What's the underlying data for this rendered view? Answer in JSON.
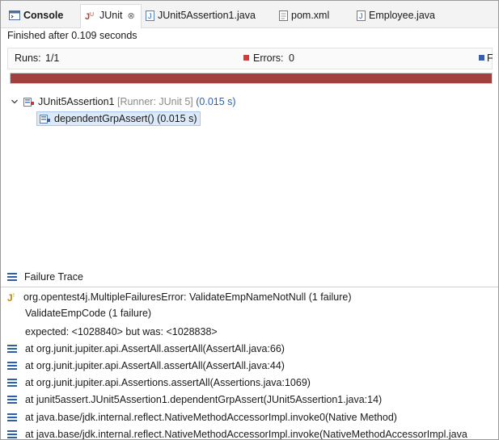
{
  "tabs": [
    {
      "label": "Console",
      "icon": "console-icon"
    },
    {
      "label": "JUnit",
      "icon": "junit-icon",
      "close": "⊗"
    },
    {
      "label": "JUnit5Assertion1.java",
      "icon": "java-file-icon"
    },
    {
      "label": "pom.xml",
      "icon": "xml-file-icon"
    },
    {
      "label": "Employee.java",
      "icon": "java-file-icon"
    }
  ],
  "status": {
    "finished": "Finished after 0.109 seconds"
  },
  "counters": {
    "runs_label": "Runs:",
    "runs_value": "1/1",
    "errors_label": "Errors:",
    "errors_value": "0",
    "failures_label": "F"
  },
  "progress": {
    "fraction": 1.0,
    "color": "#a23f3f"
  },
  "tree": {
    "suite": {
      "name": "JUnit5Assertion1",
      "runner": "[Runner: JUnit 5]",
      "time": "(0.015 s)"
    },
    "test": {
      "name": "dependentGrpAssert()",
      "time": "(0.015 s)"
    }
  },
  "failure_trace": {
    "title": "Failure Trace",
    "lines": [
      "org.opentest4j.MultipleFailuresError: ValidateEmpNameNotNull (1 failure)",
      "ValidateEmpCode (1 failure)",
      "expected: <1028840> but was: <1028838>",
      "at org.junit.jupiter.api.AssertAll.assertAll(AssertAll.java:66)",
      "at org.junit.jupiter.api.AssertAll.assertAll(AssertAll.java:44)",
      "at org.junit.jupiter.api.Assertions.assertAll(Assertions.java:1069)",
      "at junit5assert.JUnit5Assertion1.dependentGrpAssert(JUnit5Assertion1.java:14)",
      "at java.base/jdk.internal.reflect.NativeMethodAccessorImpl.invoke0(Native Method)",
      "at java.base/jdk.internal.reflect.NativeMethodAccessorImpl.invoke(NativeMethodAccessorImpl.java"
    ]
  }
}
